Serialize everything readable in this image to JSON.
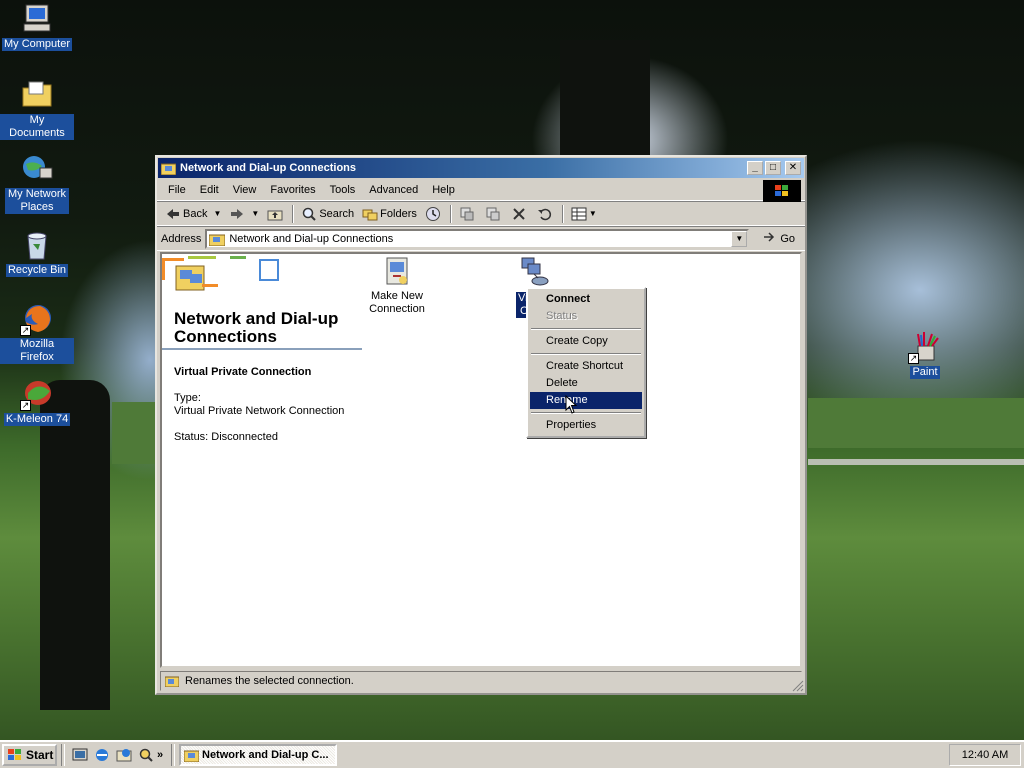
{
  "desktop": {
    "icons": [
      {
        "label": "My Computer",
        "icon": "my-computer-icon"
      },
      {
        "label": "My Documents",
        "icon": "my-documents-icon"
      },
      {
        "label": "My Network Places",
        "icon": "network-places-icon"
      },
      {
        "label": "Recycle Bin",
        "icon": "recycle-bin-icon"
      },
      {
        "label": "Mozilla Firefox",
        "icon": "firefox-icon"
      },
      {
        "label": "K-Meleon 74",
        "icon": "kmeleon-icon"
      },
      {
        "label": "Paint",
        "icon": "paint-icon"
      }
    ]
  },
  "window": {
    "title": "Network and Dial-up Connections",
    "menu": [
      "File",
      "Edit",
      "View",
      "Favorites",
      "Tools",
      "Advanced",
      "Help"
    ],
    "toolbar": {
      "back": "Back",
      "search": "Search",
      "folders": "Folders"
    },
    "address": {
      "label": "Address",
      "value": "Network and Dial-up Connections",
      "go": "Go"
    },
    "panel": {
      "title": "Network and Dial-up Connections",
      "selected_name": "Virtual Private Connection",
      "type_label": "Type:",
      "type_value": "Virtual Private Network Connection",
      "status": "Status: Disconnected"
    },
    "files": [
      {
        "label": "Make New Connection",
        "icon": "make-new-connection-icon"
      },
      {
        "label": "Vir",
        "label2": "C",
        "icon": "vpn-connection-icon",
        "selected": true
      }
    ],
    "status_text": "Renames the selected connection."
  },
  "context_menu": {
    "items": [
      "Connect",
      "Status",
      "Create Copy",
      "Create Shortcut",
      "Delete",
      "Rename",
      "Properties"
    ],
    "default": "Connect",
    "disabled": [
      "Status"
    ],
    "highlighted": "Rename"
  },
  "taskbar": {
    "start": "Start",
    "task_label": "Network and Dial-up C...",
    "clock": "12:40 AM"
  },
  "colors": {
    "title_gradient_start": "#0a246a",
    "title_gradient_end": "#a6caf0",
    "highlight": "#0a246a",
    "face": "#d4d0c8"
  }
}
